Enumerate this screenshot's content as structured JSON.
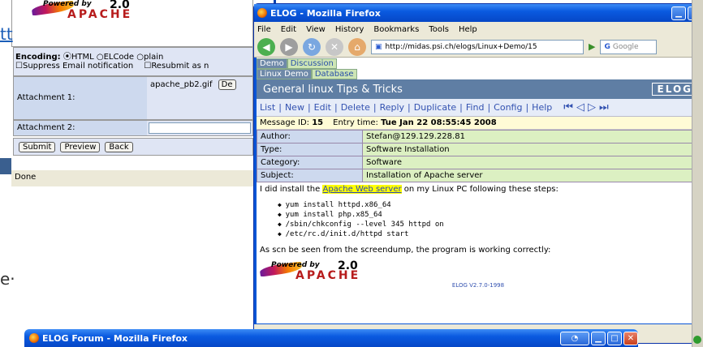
{
  "left_window": {
    "encoding_label": "Encoding:",
    "enc_opts": [
      "HTML",
      "ELCode",
      "plain"
    ],
    "suppress_label": "Suppress Email notification",
    "resubmit_label": "Resubmit as n",
    "att1_label": "Attachment 1:",
    "att1_file": "apache_pb2.gif",
    "att1_btn": "De",
    "att2_label": "Attachment 2:",
    "submit": "Submit",
    "preview": "Preview",
    "back": "Back",
    "status": "Done",
    "edge_text": "tt",
    "bottom_char": "e·"
  },
  "apache_logo": {
    "powered_by": "Powered by",
    "version": "2.0",
    "word": "APACHE"
  },
  "firefox": {
    "title": "ELOG - Mozilla Firefox",
    "menus": [
      "File",
      "Edit",
      "View",
      "History",
      "Bookmarks",
      "Tools",
      "Help"
    ],
    "url": "http://midas.psi.ch/elogs/Linux+Demo/15",
    "search_placeholder": "Google",
    "tabs_row1": [
      "Demo",
      "Discussion"
    ],
    "tabs_row2": [
      "Linux Demo",
      "Database"
    ],
    "header_title": "General linux Tips & Tricks",
    "logo_text": "ELOG",
    "menu_items": [
      "List",
      "New",
      "Edit",
      "Delete",
      "Reply",
      "Duplicate",
      "Find",
      "Config",
      "Help"
    ],
    "message_id_label": "Message ID:",
    "message_id": "15",
    "entry_time_label": "Entry time:",
    "entry_time": "Tue Jan 22 08:55:45 2008",
    "attributes": [
      {
        "key": "Author:",
        "value": "Stefan@129.129.228.81"
      },
      {
        "key": "Type:",
        "value": "Software Installation"
      },
      {
        "key": "Category:",
        "value": "Software"
      },
      {
        "key": "Subject:",
        "value": "Installation of Apache server"
      }
    ],
    "body_pre": "I did install the ",
    "body_link": "Apache Web server",
    "body_post": " on my Linux PC following these steps:",
    "commands": [
      "yum install httpd.x86_64",
      "yum install php.x85_64",
      "/sbin/chkconfig --level 345 httpd on",
      "/etc/rc.d/init.d/httpd start"
    ],
    "body_end": "As scn be seen from the screendump, the program is working correctly:",
    "version_footer": "ELOG V2.7.0-1998"
  },
  "bottom_window": {
    "title": "ELOG Forum - Mozilla Firefox"
  }
}
